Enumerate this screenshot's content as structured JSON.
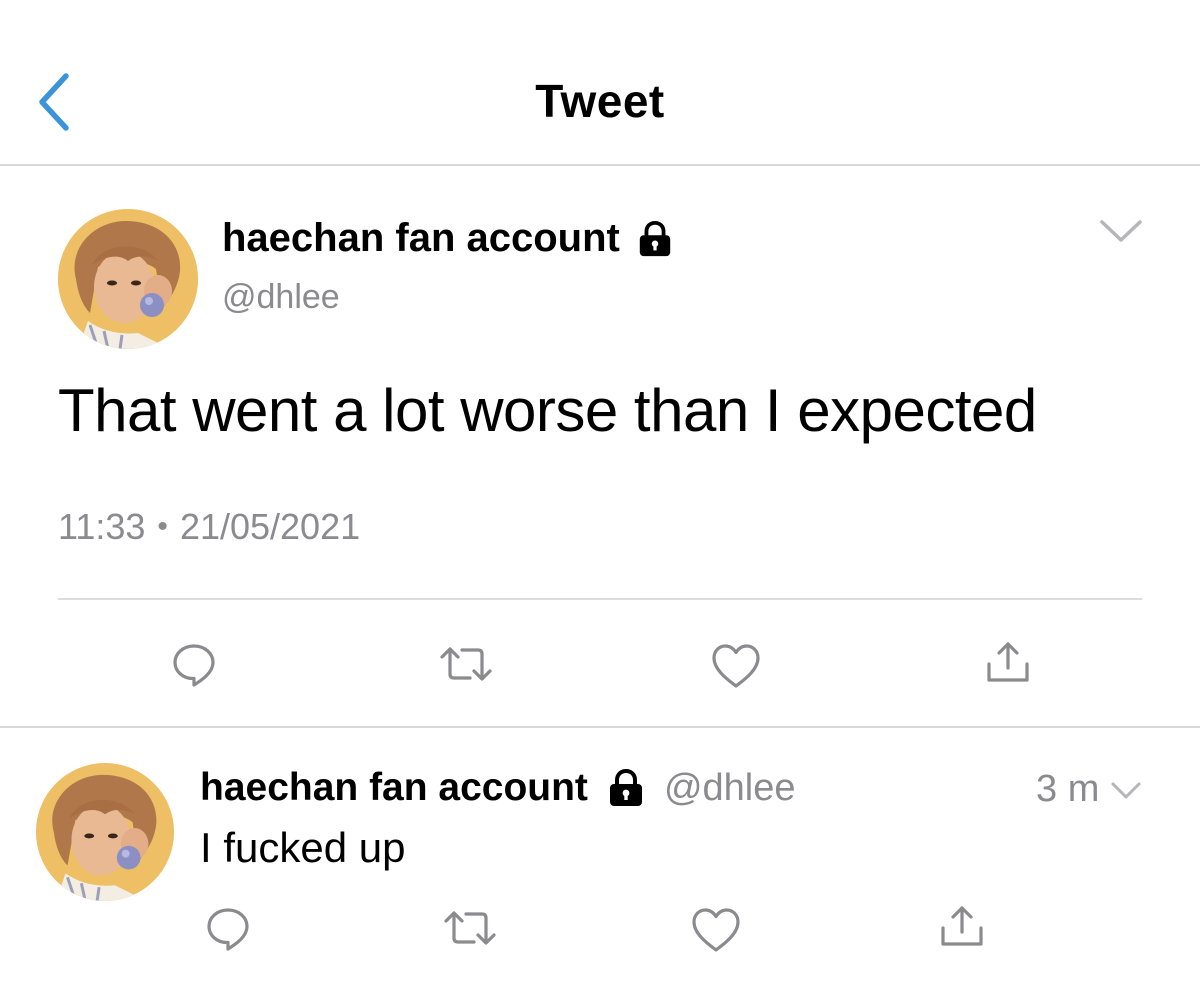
{
  "header": {
    "title": "Tweet",
    "back_icon": "chevron-left-icon"
  },
  "colors": {
    "accent": "#3b94d9",
    "icon_gray": "#8a8a8f",
    "divider": "#d8d8d8"
  },
  "main_tweet": {
    "display_name": "haechan fan account",
    "protected_icon": "lock-icon",
    "handle": "@dhlee",
    "text": "That went a lot worse than I expected",
    "time": "11:33",
    "separator": "•",
    "date": "21/05/2021",
    "menu_icon": "chevron-down-icon",
    "actions": [
      "reply-icon",
      "retweet-icon",
      "like-icon",
      "share-icon"
    ]
  },
  "reply_tweet": {
    "display_name": "haechan fan account",
    "protected_icon": "lock-icon",
    "handle": "@dhlee",
    "relative_time": "3 m",
    "text": "I fucked up",
    "menu_icon": "chevron-down-icon",
    "actions": [
      "reply-icon",
      "retweet-icon",
      "like-icon",
      "share-icon"
    ]
  }
}
